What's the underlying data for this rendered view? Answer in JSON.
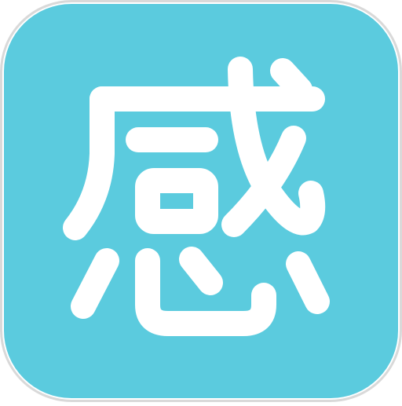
{
  "app_icon": {
    "glyph": "感",
    "background_color": "#5BCBDE",
    "border_color": "#D9D9D9",
    "glyph_color": "#FFFFFF"
  }
}
